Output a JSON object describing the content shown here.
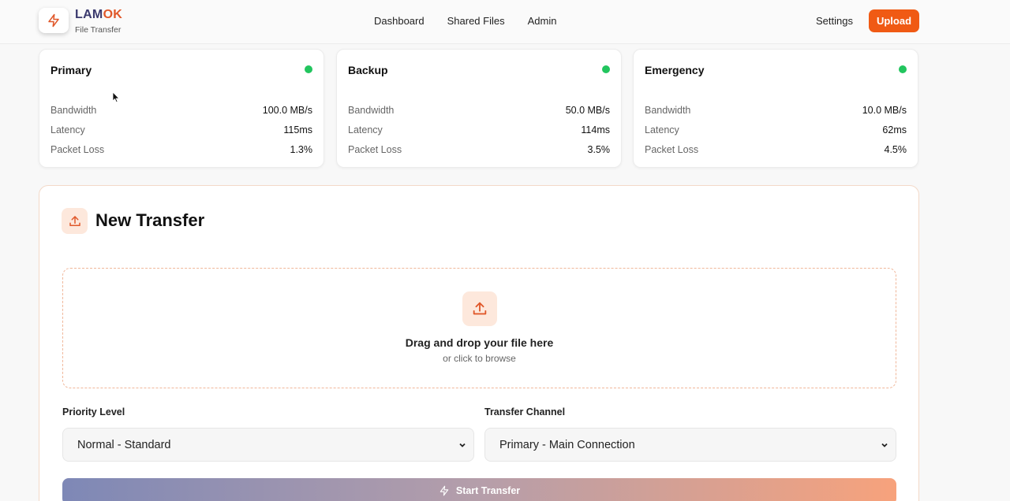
{
  "brand": {
    "name_part1": "LAM",
    "name_part2": "OK",
    "subtitle": "File Transfer"
  },
  "nav": {
    "items": [
      "Dashboard",
      "Shared Files",
      "Admin"
    ],
    "settings": "Settings",
    "upload": "Upload"
  },
  "channels": [
    {
      "name": "Primary",
      "status_color": "#22c55e",
      "bandwidth_label": "Bandwidth",
      "bandwidth": "100.0 MB/s",
      "latency_label": "Latency",
      "latency": "115ms",
      "loss_label": "Packet Loss",
      "loss": "1.3%"
    },
    {
      "name": "Backup",
      "status_color": "#22c55e",
      "bandwidth_label": "Bandwidth",
      "bandwidth": "50.0 MB/s",
      "latency_label": "Latency",
      "latency": "114ms",
      "loss_label": "Packet Loss",
      "loss": "3.5%"
    },
    {
      "name": "Emergency",
      "status_color": "#22c55e",
      "bandwidth_label": "Bandwidth",
      "bandwidth": "10.0 MB/s",
      "latency_label": "Latency",
      "latency": "62ms",
      "loss_label": "Packet Loss",
      "loss": "4.5%"
    }
  ],
  "transfer": {
    "title": "New Transfer",
    "dropzone_title": "Drag and drop your file here",
    "dropzone_sub": "or click to browse",
    "priority_label": "Priority Level",
    "priority_value": "Normal - Standard",
    "channel_label": "Transfer Channel",
    "channel_value": "Primary - Main Connection",
    "start_label": "Start Transfer"
  },
  "colors": {
    "accent": "#f05a14",
    "status_ok": "#22c55e"
  },
  "icons": {
    "logo": "bolt-icon",
    "upload": "upload-icon",
    "select": "chevron-down-icon"
  }
}
